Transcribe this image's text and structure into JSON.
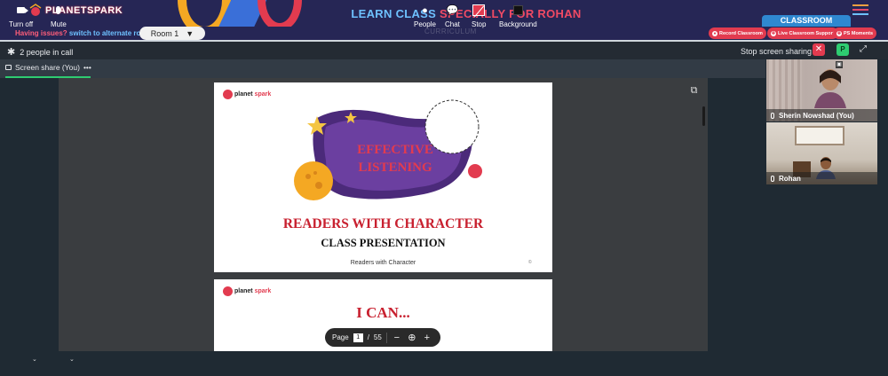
{
  "banner": {
    "brand": "PLANETSPARK",
    "title_part1": "LEARN CLASS",
    "title_part2": "SPECIALLY FOR ROHAN",
    "classroom_tab": "CLASSROOM"
  },
  "subbar": {
    "issues_text": "Having issues?",
    "switch_link": "switch to alternate room",
    "room_selected": "Room 1",
    "curriculum_label": "CURRICULUM",
    "record_button": "Record Classroom",
    "support_button": "Live Classroom Support",
    "moments_button": "PS Moments"
  },
  "call": {
    "people_count": "2 people in call",
    "stop_sharing": "Stop screen sharing",
    "presenter_badge": "P"
  },
  "tabs": [
    {
      "label": "Screen share (You)",
      "active": true
    }
  ],
  "slides": {
    "logo_text_1": "planet",
    "logo_text_2": "spark",
    "slide1": {
      "art_line1": "EFFECTIVE",
      "art_line2": "LISTENING",
      "title": "READERS WITH CHARACTER",
      "subtitle": "CLASS PRESENTATION",
      "footer": "Readers with Character",
      "footer_mark": "©"
    },
    "slide2": {
      "title": "I CAN..."
    }
  },
  "pager": {
    "label": "Page",
    "current": "1",
    "separator": "/",
    "total": "55"
  },
  "participants": [
    {
      "name": "Sherin Nowshad (You)"
    },
    {
      "name": "Rohan"
    }
  ],
  "controls": {
    "camera": "Turn off",
    "mic": "Mute",
    "people": "People",
    "chat": "Chat",
    "stop": "Stop",
    "background": "Background"
  },
  "colors": {
    "banner_bg": "#262655",
    "accent_red": "#e23b4f",
    "accent_blue": "#2f88d0",
    "accent_green": "#2ecc71",
    "call_bg": "#1f2a33"
  }
}
